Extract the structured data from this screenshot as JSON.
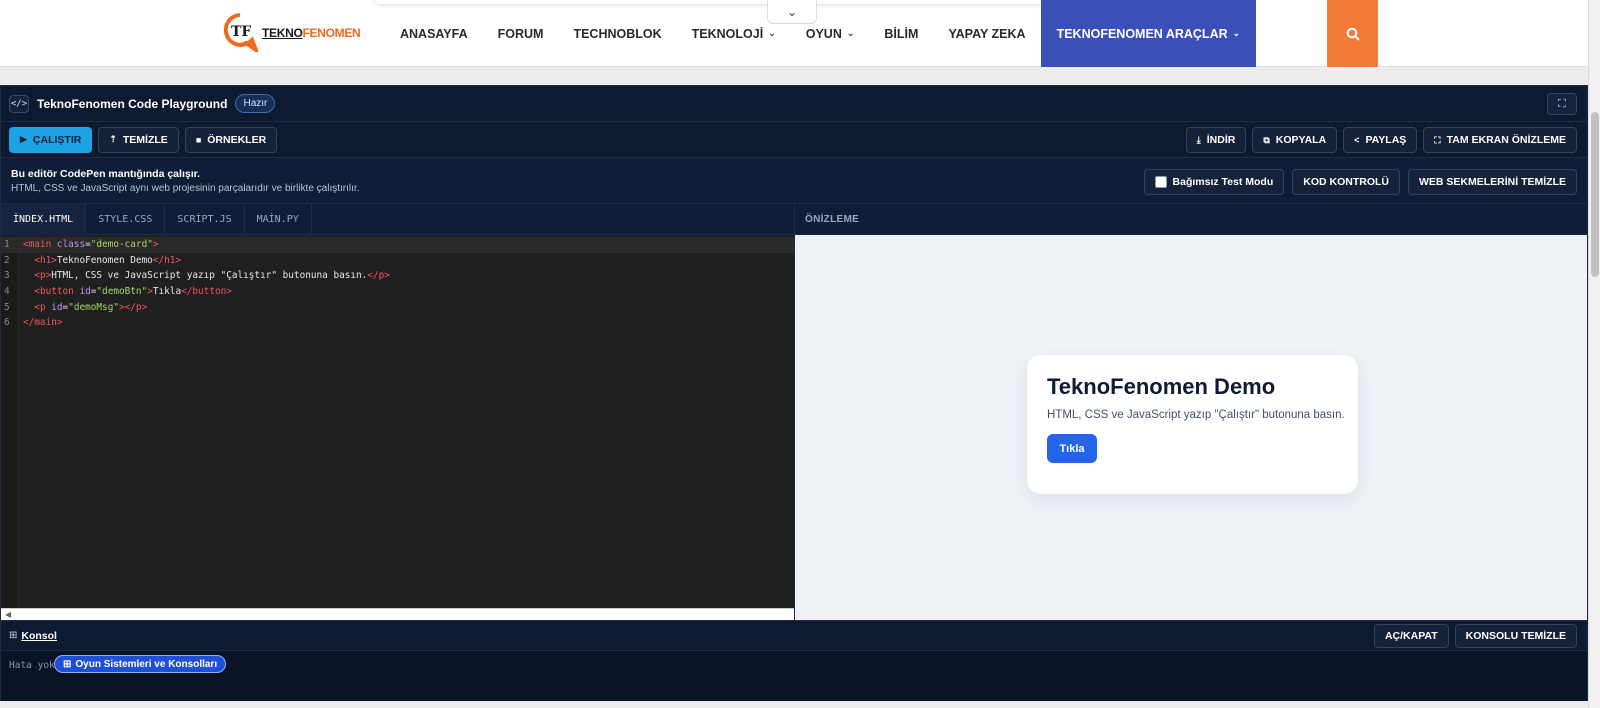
{
  "site": {
    "nav": [
      {
        "label": "ANASAYFA",
        "chevron": false,
        "active": false
      },
      {
        "label": "FORUM",
        "chevron": false,
        "active": false
      },
      {
        "label": "TECHNOBLOK",
        "chevron": false,
        "active": false
      },
      {
        "label": "TEKNOLOJİ",
        "chevron": true,
        "active": false
      },
      {
        "label": "OYUN",
        "chevron": true,
        "active": false
      },
      {
        "label": "BİLİM",
        "chevron": false,
        "active": false
      },
      {
        "label": "YAPAY ZEKA",
        "chevron": false,
        "active": false
      },
      {
        "label": "TEKNOFENOMEN ARAÇLAR",
        "chevron": true,
        "active": true
      }
    ],
    "logo_a": "TEKNO",
    "logo_b": "FENOMEN",
    "accent": "#3b4fb8",
    "search_color": "#f47a3a"
  },
  "playground": {
    "title": "TeknoFenomen Code Playground",
    "status": "Hazır",
    "toolbar_left": [
      {
        "label": "ÇALIŞTIR",
        "icon": "play-icon",
        "glyph": "▶"
      },
      {
        "label": "TEMİZLE",
        "icon": "clear-icon",
        "glyph": "⇡"
      },
      {
        "label": "ÖRNEKLER",
        "icon": "file-icon",
        "glyph": "■"
      }
    ],
    "toolbar_right": [
      {
        "label": "İNDİR",
        "icon": "download-icon",
        "glyph": "⤓"
      },
      {
        "label": "KOPYALA",
        "icon": "copy-icon",
        "glyph": "⧉"
      },
      {
        "label": "PAYLAŞ",
        "icon": "share-icon",
        "glyph": "<"
      },
      {
        "label": "TAM EKRAN ÖNİZLEME",
        "icon": "expand-icon",
        "glyph": "⛶"
      }
    ],
    "info_title": "Bu editör CodePen mantığında çalışır.",
    "info_sub": "HTML, CSS ve JavaScript aynı web projesinin parçalarıdır ve birlikte çalıştırılır.",
    "test_mode_label": "Bağımsız Test Modu",
    "code_check_label": "KOD KONTROLÜ",
    "clear_tabs_label": "WEB SEKMELERİNİ TEMİZLE",
    "tabs": [
      "İNDEX.HTML",
      "STYLE.CSS",
      "SCRİPT.JS",
      "MAİN.PY"
    ],
    "active_tab": 0,
    "preview_label": "ÖNİZLEME",
    "code": [
      [
        [
          "tag",
          "<main "
        ],
        [
          "attr",
          "class"
        ],
        [
          "txt",
          "="
        ],
        [
          "str",
          "\"demo-card\""
        ],
        [
          "tag",
          ">"
        ]
      ],
      [
        [
          "txt",
          "  "
        ],
        [
          "tag",
          "<h1>"
        ],
        [
          "txt",
          "TeknoFenomen Demo"
        ],
        [
          "tag",
          "</h1>"
        ]
      ],
      [
        [
          "txt",
          "  "
        ],
        [
          "tag",
          "<p>"
        ],
        [
          "txt",
          "HTML, CSS ve JavaScript yazıp \"Çalıştır\" butonuna basın."
        ],
        [
          "tag",
          "</p>"
        ]
      ],
      [
        [
          "txt",
          "  "
        ],
        [
          "tag",
          "<button "
        ],
        [
          "attr",
          "id"
        ],
        [
          "txt",
          "="
        ],
        [
          "str",
          "\"demoBtn\""
        ],
        [
          "tag",
          ">"
        ],
        [
          "txt",
          "Tıkla"
        ],
        [
          "tag",
          "</button>"
        ]
      ],
      [
        [
          "txt",
          "  "
        ],
        [
          "tag",
          "<p "
        ],
        [
          "attr",
          "id"
        ],
        [
          "txt",
          "="
        ],
        [
          "str",
          "\"demoMsg\""
        ],
        [
          "tag",
          "></p>"
        ]
      ],
      [
        [
          "tag",
          "</main>"
        ]
      ]
    ],
    "demo": {
      "heading": "TeknoFenomen Demo",
      "text": "HTML, CSS ve JavaScript yazıp \"Çalıştır\" butonuna basın.",
      "button": "Tıkla"
    },
    "console": {
      "title": "Konsol",
      "text": "Hata yok",
      "toggle_label": "AÇ/KAPAT",
      "clear_label": "KONSOLU TEMİZLE",
      "chip": "Oyun Sistemleri ve Konsolları"
    }
  }
}
